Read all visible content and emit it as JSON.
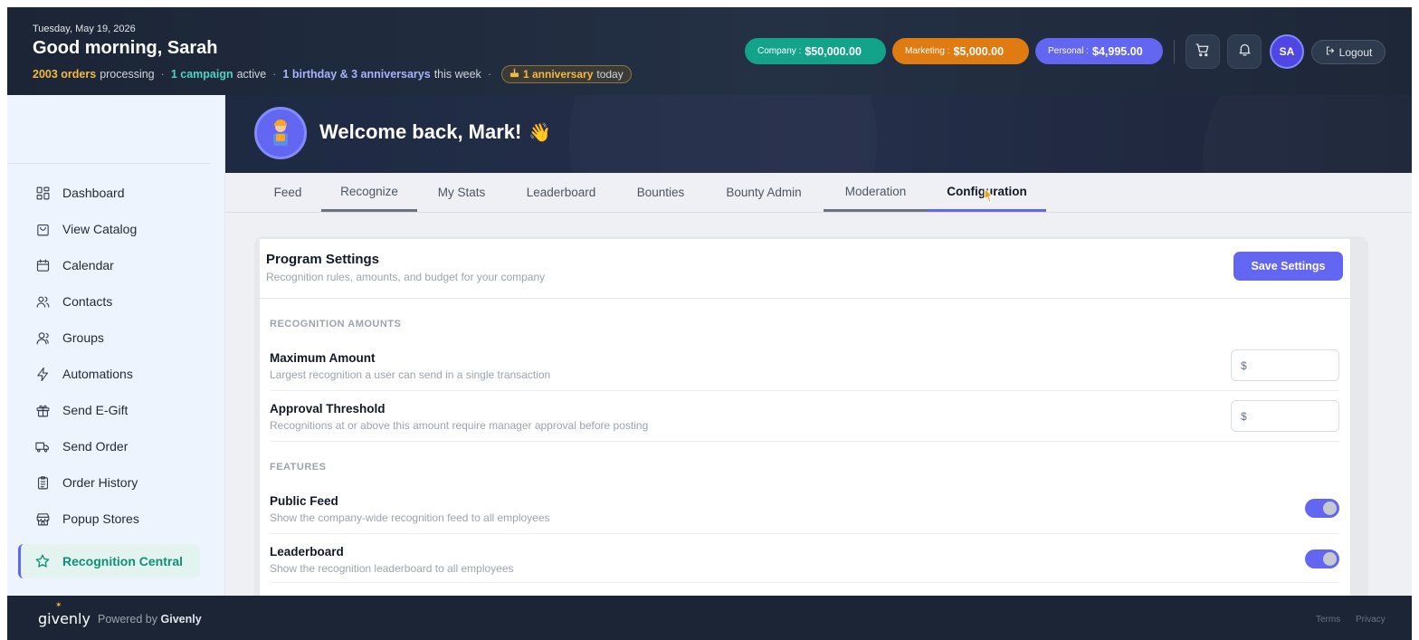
{
  "header": {
    "date": "Tuesday, May 19, 2026",
    "greeting": "Good morning, Sarah",
    "status": {
      "orders_count": "2003 orders",
      "orders_suffix": "processing",
      "campaign": "1 campaign",
      "campaign_suffix": "active",
      "celebrations": "1 birthday & 3 anniversarys",
      "celebrations_suffix": "this week",
      "today_pill": "1 anniversary",
      "today_suffix": "today"
    },
    "budgets": {
      "company_label": "Company :",
      "company_value": "$50,000.00",
      "marketing_label": "Marketing :",
      "marketing_value": "$5,000.00",
      "personal_label": "Personal :",
      "personal_value": "$4,995.00"
    },
    "user_initials": "SA",
    "logout_label": "Logout"
  },
  "sidebar": {
    "items": [
      {
        "label": "Dashboard",
        "icon": "dashboard-icon"
      },
      {
        "label": "View Catalog",
        "icon": "bag-icon"
      },
      {
        "label": "Calendar",
        "icon": "calendar-icon"
      },
      {
        "label": "Contacts",
        "icon": "contacts-icon"
      },
      {
        "label": "Groups",
        "icon": "groups-icon"
      },
      {
        "label": "Automations",
        "icon": "lightning-icon"
      },
      {
        "label": "Send E-Gift",
        "icon": "gift-icon"
      },
      {
        "label": "Send Order",
        "icon": "truck-icon"
      },
      {
        "label": "Order History",
        "icon": "clipboard-icon"
      },
      {
        "label": "Popup Stores",
        "icon": "store-icon"
      },
      {
        "label": "Recognition Central",
        "icon": "star-icon",
        "active": true
      }
    ]
  },
  "hero": {
    "welcome": "Welcome back, Mark!",
    "wave": "👋"
  },
  "tabs": [
    {
      "label": "Feed"
    },
    {
      "label": "Recognize"
    },
    {
      "label": "My Stats"
    },
    {
      "label": "Leaderboard"
    },
    {
      "label": "Bounties"
    },
    {
      "label": "Bounty Admin"
    },
    {
      "label": "Moderation"
    },
    {
      "label": "Configuration",
      "selected": true
    }
  ],
  "settings": {
    "title": "Program Settings",
    "subtitle": "Recognition rules, amounts, and budget for your company",
    "save_label": "Save Settings",
    "amounts_section": "RECOGNITION AMOUNTS",
    "max_title": "Maximum Amount",
    "max_desc": "Largest recognition a user can send in a single transaction",
    "max_value": "",
    "approval_title": "Approval Threshold",
    "approval_desc": "Recognitions at or above this amount require manager approval before posting",
    "approval_value": "",
    "currency_symbol": "$",
    "features_section": "FEATURES",
    "feed_title": "Public Feed",
    "feed_desc": "Show the company-wide recognition feed to all employees",
    "feed_enabled": true,
    "leaderboard_title": "Leaderboard",
    "leaderboard_desc": "Show the recognition leaderboard to all employees",
    "leaderboard_enabled": true
  },
  "footer": {
    "logo": "givenly",
    "powered_prefix": "Powered by",
    "powered_brand": "Givenly",
    "terms": "Terms",
    "privacy": "Privacy"
  },
  "colors": {
    "accent": "#6366f1",
    "company": "#13a38a",
    "marketing": "#e07b12",
    "active_nav_text": "#0f8f76"
  }
}
